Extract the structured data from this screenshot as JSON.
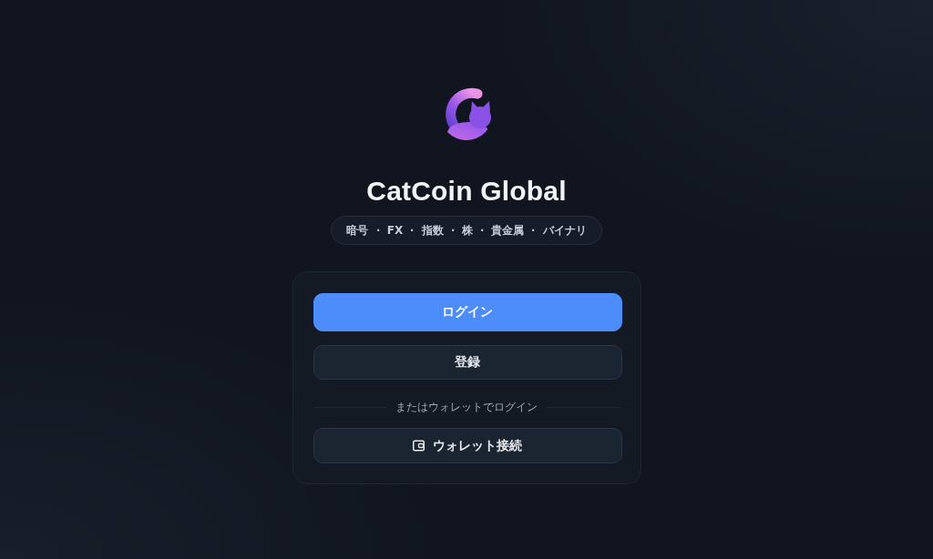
{
  "brand": {
    "title": "CatCoin Global",
    "tagline": "暗号 ・ FX ・ 指数 ・ 株 ・ 貴金属 ・ バイナリ"
  },
  "auth_card": {
    "buttons": [
      {
        "label": "ログイン",
        "kind": "primary"
      },
      {
        "label": "登録",
        "kind": "secondary"
      }
    ],
    "divider_text": "またはウォレットでログイン",
    "wallet_button": {
      "label": "ウォレット接続"
    }
  }
}
